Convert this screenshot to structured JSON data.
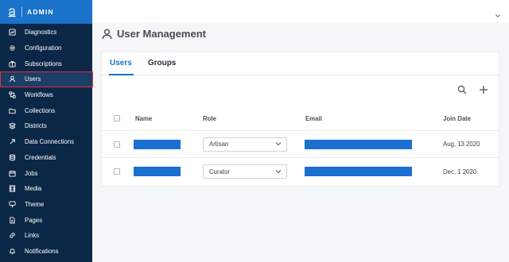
{
  "brand": {
    "name": "ADMIN",
    "logo_icon": "anchor-a-icon",
    "color": "#1a72c9"
  },
  "sidebar": {
    "bg": "#0b2747",
    "items": [
      {
        "label": "Diagnostics",
        "icon": "chart-box-icon"
      },
      {
        "label": "Configuration",
        "icon": "gear-icon"
      },
      {
        "label": "Subscriptions",
        "icon": "briefcase-icon"
      },
      {
        "label": "Users",
        "icon": "user-icon",
        "active": true
      },
      {
        "label": "Workflows",
        "icon": "workflow-icon"
      },
      {
        "label": "Collections",
        "icon": "folder-icon"
      },
      {
        "label": "Districts",
        "icon": "layers-icon"
      },
      {
        "label": "Data Connections",
        "icon": "arrow-diagonal-icon"
      },
      {
        "label": "Credentials",
        "icon": "database-icon"
      },
      {
        "label": "Jobs",
        "icon": "calendar-icon"
      },
      {
        "label": "Media",
        "icon": "film-icon"
      },
      {
        "label": "Theme",
        "icon": "palette-icon"
      },
      {
        "label": "Pages",
        "icon": "document-icon"
      },
      {
        "label": "Links",
        "icon": "link-icon"
      },
      {
        "label": "Notifications",
        "icon": "bell-icon"
      }
    ]
  },
  "page": {
    "title": "User Management",
    "title_icon": "user-outline-icon"
  },
  "tabs": [
    {
      "label": "Users",
      "active": true
    },
    {
      "label": "Groups",
      "active": false
    }
  ],
  "toolbar": {
    "search_icon": "search-icon",
    "add_icon": "plus-icon"
  },
  "table": {
    "columns": {
      "name": "Name",
      "role": "Role",
      "email": "Email",
      "join_date": "Join Date"
    },
    "rows": [
      {
        "name": "",
        "role": "Artisan",
        "email": "",
        "join_date": "Aug, 13 2020"
      },
      {
        "name": "",
        "role": "Curator",
        "email": "",
        "join_date": "Dec, 1 2020"
      }
    ]
  },
  "colors": {
    "accent": "#1a72c9",
    "highlight_border": "#e0303a"
  }
}
